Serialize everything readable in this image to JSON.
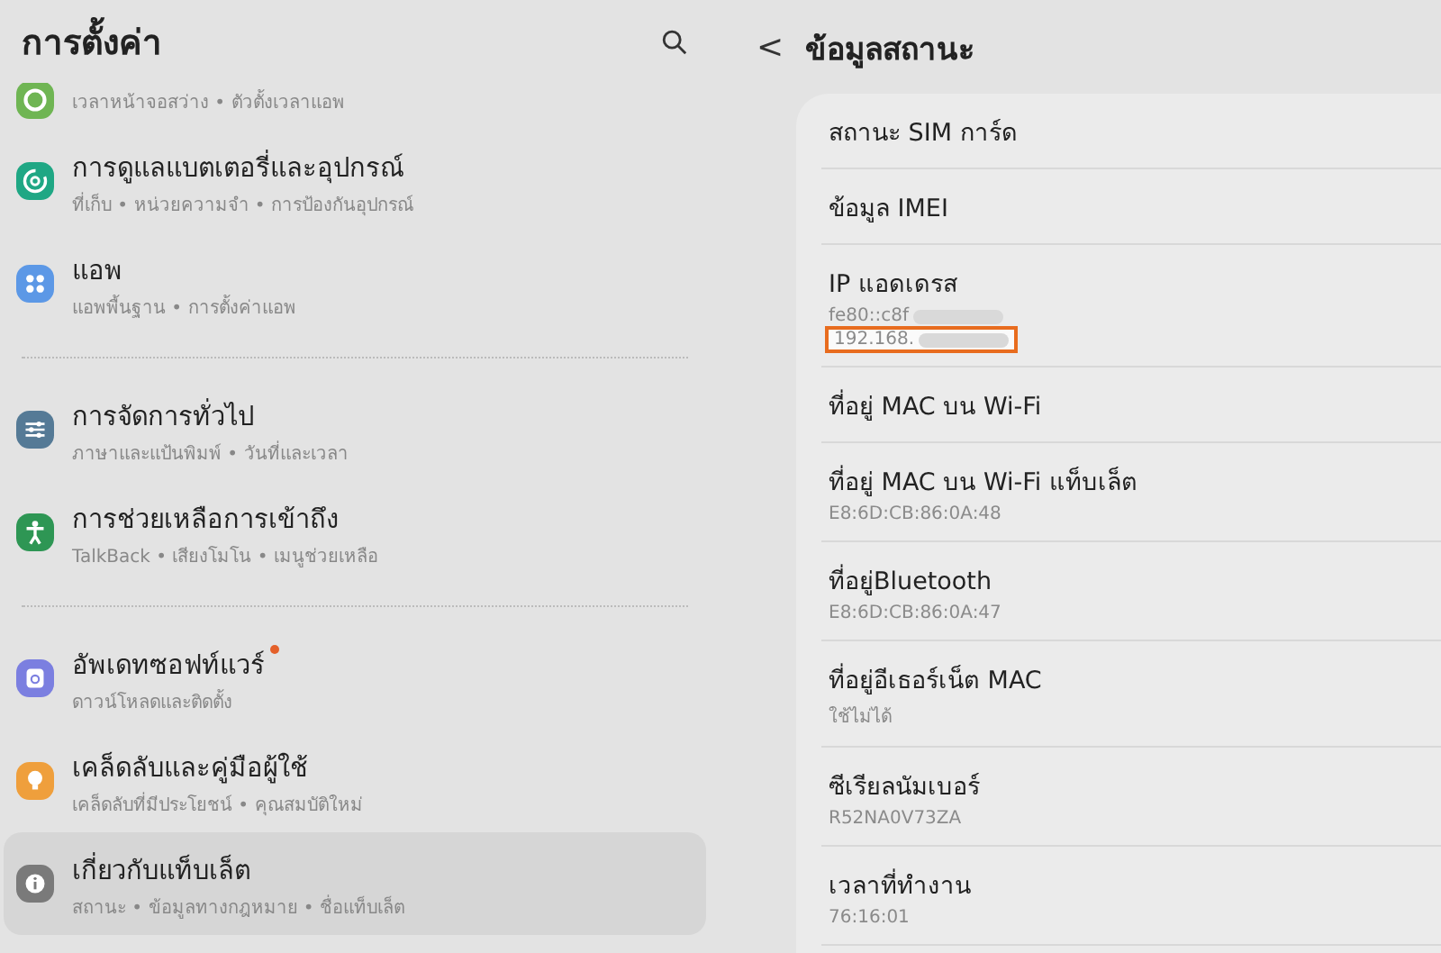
{
  "settings": {
    "title": "การตั้งค่า",
    "groups": [
      {
        "items": [
          {
            "kind": "partial",
            "subtitle": "เวลาหน้าจอสว่าง • ตัวตั้งเวลาแอพ",
            "color": "#6fb553",
            "selected": false,
            "badge": false
          },
          {
            "kind": "full",
            "title": "การดูแลแบตเตอรี่และอุปกรณ์",
            "subtitle": "ที่เก็บ • หน่วยความจำ • การป้องกันอุปกรณ์",
            "color": "#1fa784",
            "selected": false,
            "badge": false
          },
          {
            "kind": "full",
            "title": "แอพ",
            "subtitle": "แอพพื้นฐาน • การตั้งค่าแอพ",
            "color": "#5c98e6",
            "selected": false,
            "badge": false
          }
        ]
      },
      {
        "items": [
          {
            "kind": "full",
            "title": "การจัดการทั่วไป",
            "subtitle": "ภาษาและแป้นพิมพ์ • วันที่และเวลา",
            "color": "#557a96",
            "selected": false,
            "badge": false
          },
          {
            "kind": "full",
            "title": "การช่วยเหลือการเข้าถึง",
            "subtitle": "TalkBack • เสียงโมโน • เมนูช่วยเหลือ",
            "color": "#2e9654",
            "selected": false,
            "badge": false
          }
        ]
      },
      {
        "items": [
          {
            "kind": "full",
            "title": "อัพเดทซอฟท์แวร์",
            "subtitle": "ดาวน์โหลดและติดตั้ง",
            "color": "#7b7fe0",
            "selected": false,
            "badge": true
          },
          {
            "kind": "full",
            "title": "เคล็ดลับและคู่มือผู้ใช้",
            "subtitle": "เคล็ดลับที่มีประโยชน์ • คุณสมบัติใหม่",
            "color": "#ef9f3c",
            "selected": false,
            "badge": false
          },
          {
            "kind": "full",
            "title": "เกี่ยวกับแท็บเล็ต",
            "subtitle": "สถานะ • ข้อมูลทางกฎหมาย • ชื่อแท็บเล็ต",
            "color": "#7a7a7a",
            "selected": true,
            "badge": false
          }
        ]
      }
    ]
  },
  "status_info": {
    "back": "<",
    "title": "ข้อมูลสถานะ",
    "rows": [
      {
        "title": "สถานะ SIM การ์ด",
        "values": []
      },
      {
        "title": "ข้อมูล IMEI",
        "values": []
      },
      {
        "title": "IP แอดเดรส",
        "values": [
          {
            "text": "fe80::c8f",
            "blurred": true,
            "highlighted": false
          },
          {
            "text": "192.168.",
            "blurred": true,
            "highlighted": true
          }
        ]
      },
      {
        "title": "ที่อยู่ MAC บน Wi-Fi",
        "values": []
      },
      {
        "title": "ที่อยู่ MAC บน Wi-Fi แท็บเล็ต",
        "values": [
          {
            "text": "E8:6D:CB:86:0A:48",
            "blurred": false,
            "highlighted": false
          }
        ]
      },
      {
        "title": "ที่อยู่Bluetooth",
        "values": [
          {
            "text": "E8:6D:CB:86:0A:47",
            "blurred": false,
            "highlighted": false
          }
        ]
      },
      {
        "title": "ที่อยู่อีเธอร์เน็ต MAC",
        "values": [
          {
            "text": "ใช้ไม่ได้",
            "blurred": false,
            "highlighted": false
          }
        ]
      },
      {
        "title": "ซีเรียลนัมเบอร์",
        "values": [
          {
            "text": "R52NA0V73ZA",
            "blurred": false,
            "highlighted": false
          }
        ]
      },
      {
        "title": "เวลาที่ทำงาน",
        "values": [
          {
            "text": "76:16:01",
            "blurred": false,
            "highlighted": false
          }
        ]
      }
    ]
  }
}
